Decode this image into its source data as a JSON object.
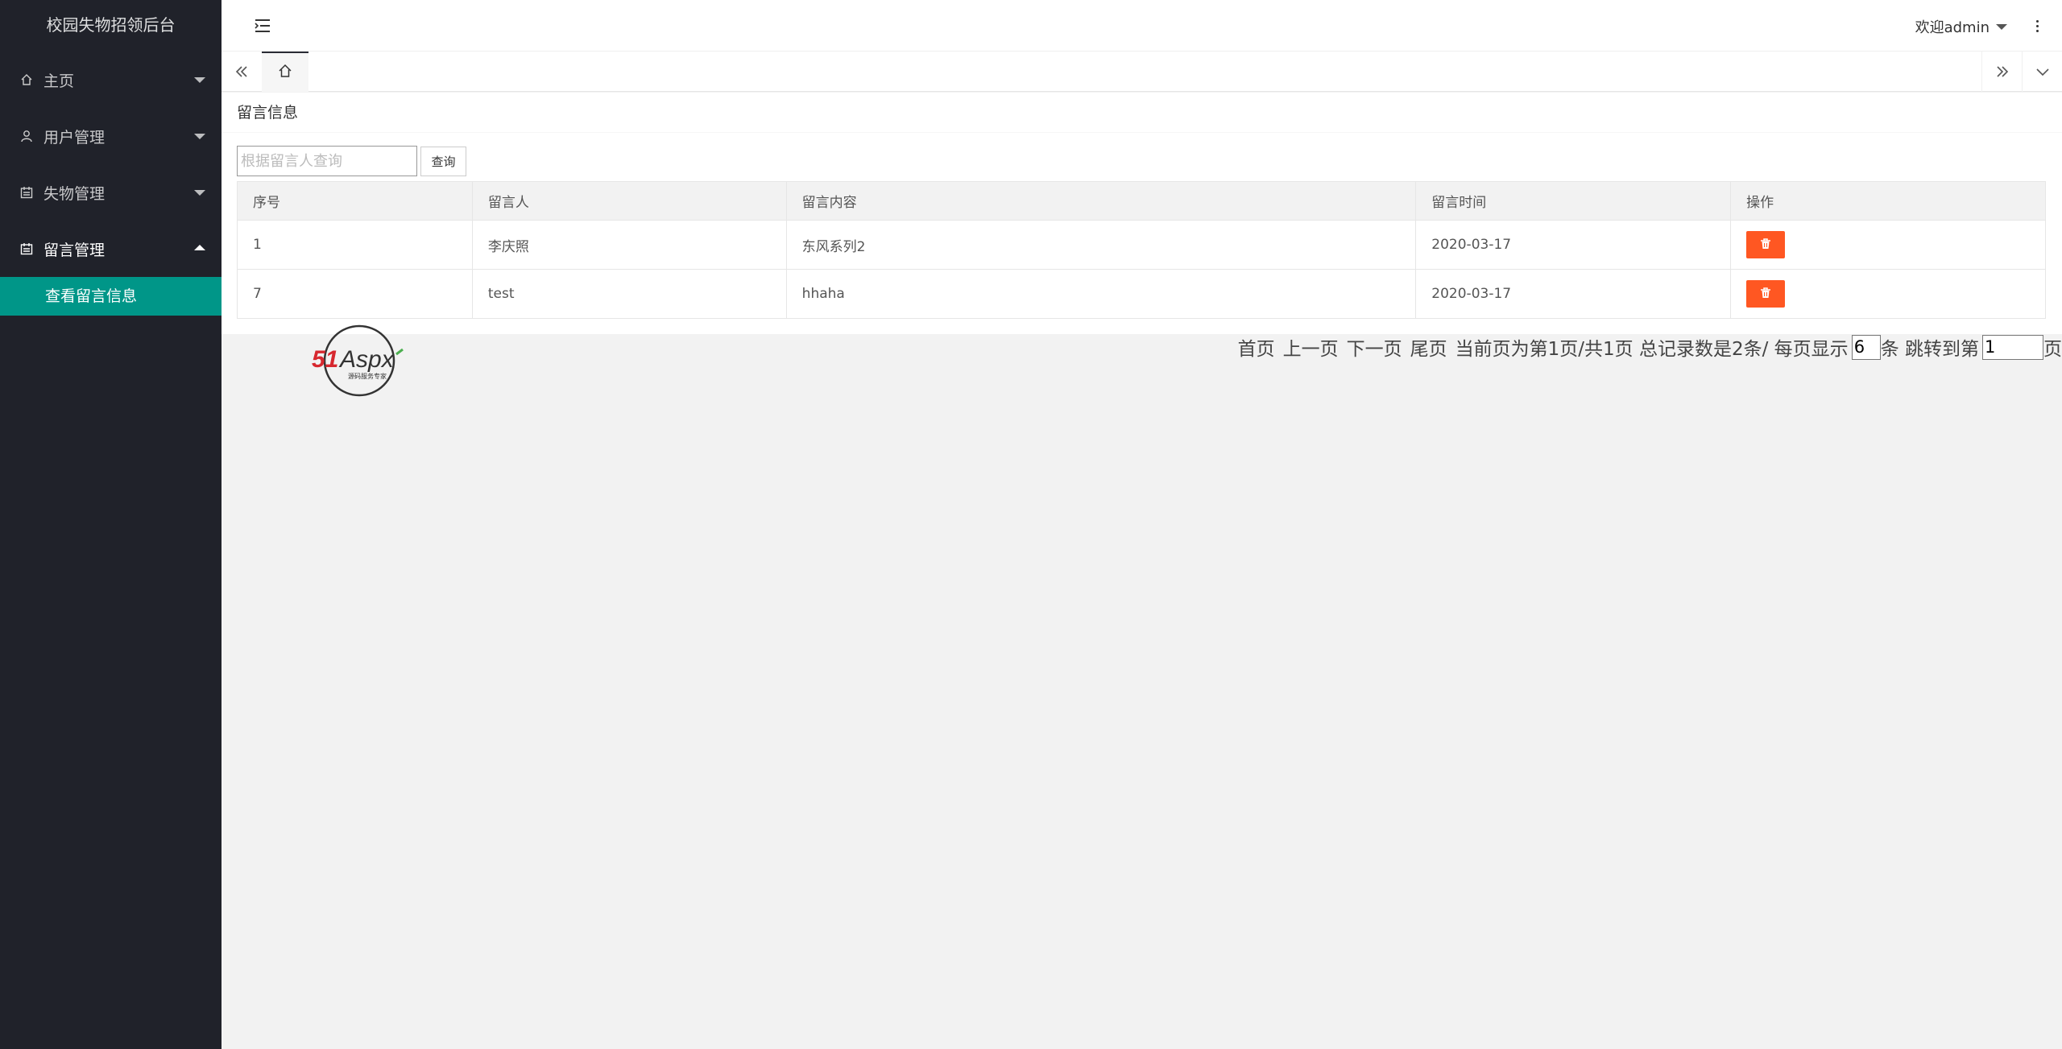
{
  "app": {
    "title": "校园失物招领后台"
  },
  "sidebar": {
    "items": [
      {
        "label": "主页",
        "icon": "home-icon",
        "open": false
      },
      {
        "label": "用户管理",
        "icon": "user-icon",
        "open": false
      },
      {
        "label": "失物管理",
        "icon": "calendar-icon",
        "open": false
      },
      {
        "label": "留言管理",
        "icon": "calendar-icon",
        "open": true
      }
    ],
    "submenu": [
      {
        "label": "查看留言信息",
        "active": true
      }
    ]
  },
  "header": {
    "user_label": "欢迎admin"
  },
  "page": {
    "title": "留言信息",
    "search": {
      "placeholder": "根据留言人查询",
      "value": "",
      "button_label": "查询"
    },
    "table": {
      "headers": [
        "序号",
        "留言人",
        "留言内容",
        "留言时间",
        "操作"
      ],
      "rows": [
        {
          "id": "1",
          "author": "李庆照",
          "content": "东风系列2",
          "time": "2020-03-17"
        },
        {
          "id": "7",
          "author": "test",
          "content": "hhaha",
          "time": "2020-03-17"
        }
      ]
    }
  },
  "pager": {
    "first": "首页",
    "prev": "上一页",
    "next": "下一页",
    "last": "尾页",
    "status": "当前页为第1页/共1页 总记录数是2条/ 每页显示",
    "per_page_value": "6",
    "per_page_unit": "条 跳转到第",
    "jump_value": "1",
    "jump_unit": "页"
  },
  "watermark": {
    "brand": "51Aspx",
    "tagline": "源码服务专家"
  },
  "colors": {
    "sidebar_bg": "#20222a",
    "accent": "#009688",
    "danger": "#ff5722"
  }
}
